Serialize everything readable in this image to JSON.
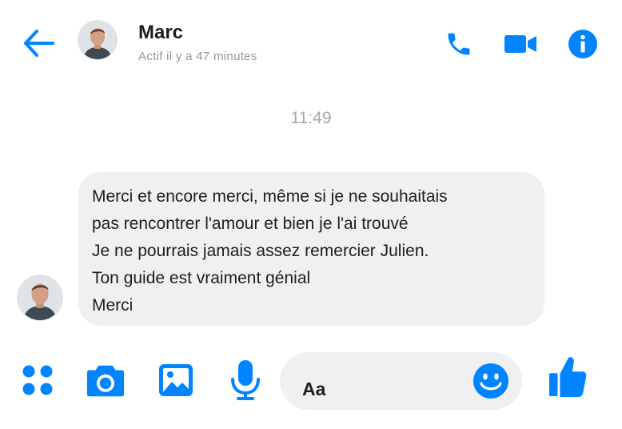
{
  "header": {
    "contact_name": "Marc",
    "status": "Actif il y a 47 minutes",
    "icons": [
      "back-arrow-icon",
      "phone-icon",
      "video-camera-icon",
      "info-icon"
    ]
  },
  "conversation": {
    "timestamp": "11:49",
    "message_lines": [
      "Merci et encore merci, même si je ne souhaitais",
      "pas rencontrer l'amour et bien je l'ai trouvé",
      "Je ne pourrais jamais assez remercier Julien.",
      "Ton guide est vraiment génial",
      "Merci"
    ]
  },
  "composer": {
    "placeholder": "Aa",
    "icons": [
      "apps-grid-icon",
      "camera-icon",
      "image-icon",
      "microphone-icon",
      "emoji-icon",
      "thumbs-up-icon"
    ]
  },
  "colors": {
    "accent": "#0084ff",
    "bubble": "#f1f0f0",
    "status_text": "#90949c",
    "timestamp_text": "#a4a7ab"
  }
}
